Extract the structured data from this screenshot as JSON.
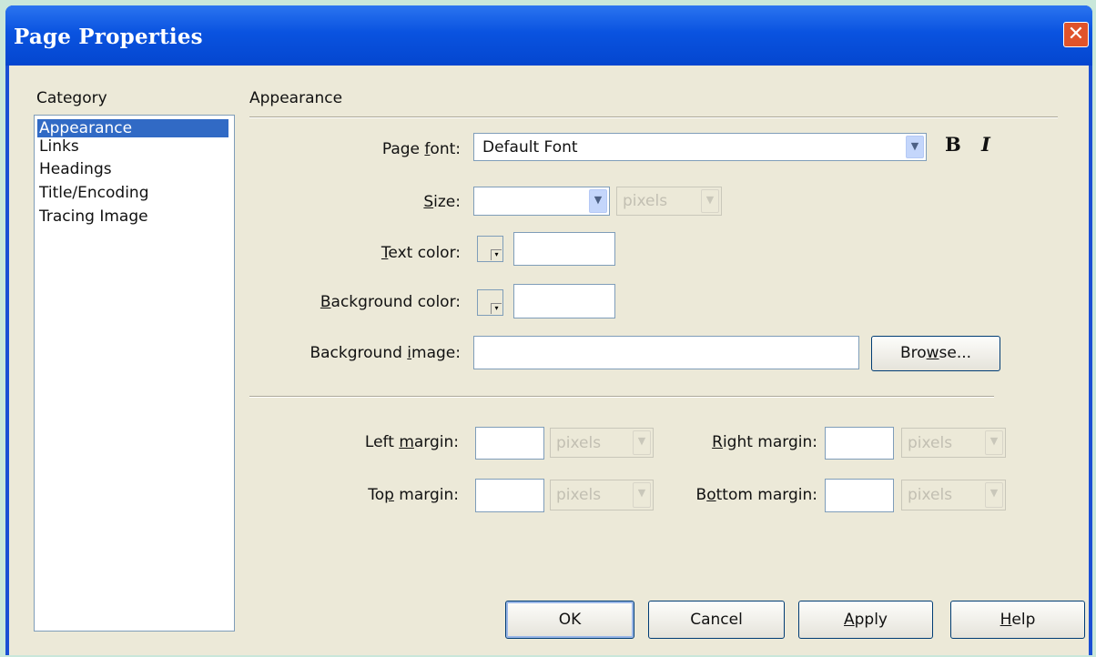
{
  "window": {
    "title": "Page Properties",
    "close_glyph": "✕"
  },
  "category": {
    "header": "Category",
    "items": [
      "Appearance",
      "Links",
      "Headings",
      "Title/Encoding",
      "Tracing Image"
    ],
    "selected_index": 0
  },
  "section": {
    "title": "Appearance"
  },
  "page_font": {
    "label": "Page font:",
    "value": "Default Font",
    "bold_label": "B",
    "italic_label": "I"
  },
  "size": {
    "label": "Size:",
    "value": "",
    "unit": "pixels"
  },
  "text_color": {
    "label": "Text color:",
    "value": ""
  },
  "bg_color": {
    "label": "Background color:",
    "value": ""
  },
  "bg_image": {
    "label": "Background image:",
    "value": "",
    "browse_label": "Browse..."
  },
  "margins": {
    "left": {
      "label": "Left margin:",
      "value": "",
      "unit": "pixels"
    },
    "right": {
      "label": "Right margin:",
      "value": "",
      "unit": "pixels"
    },
    "top": {
      "label": "Top margin:",
      "value": "",
      "unit": "pixels"
    },
    "bottom": {
      "label": "Bottom margin:",
      "value": "",
      "unit": "pixels"
    }
  },
  "buttons": {
    "ok": "OK",
    "cancel": "Cancel",
    "apply": "Apply",
    "help": "Help"
  },
  "colors": {
    "title_bar": "#0a53e0",
    "dialog_bg": "#ece9d8",
    "selection": "#316ac5",
    "close_button": "#e0532b"
  },
  "icons": {
    "close": "close-icon",
    "dropdown": "chevron-down-icon",
    "color_picker": "color-swatch-icon"
  }
}
